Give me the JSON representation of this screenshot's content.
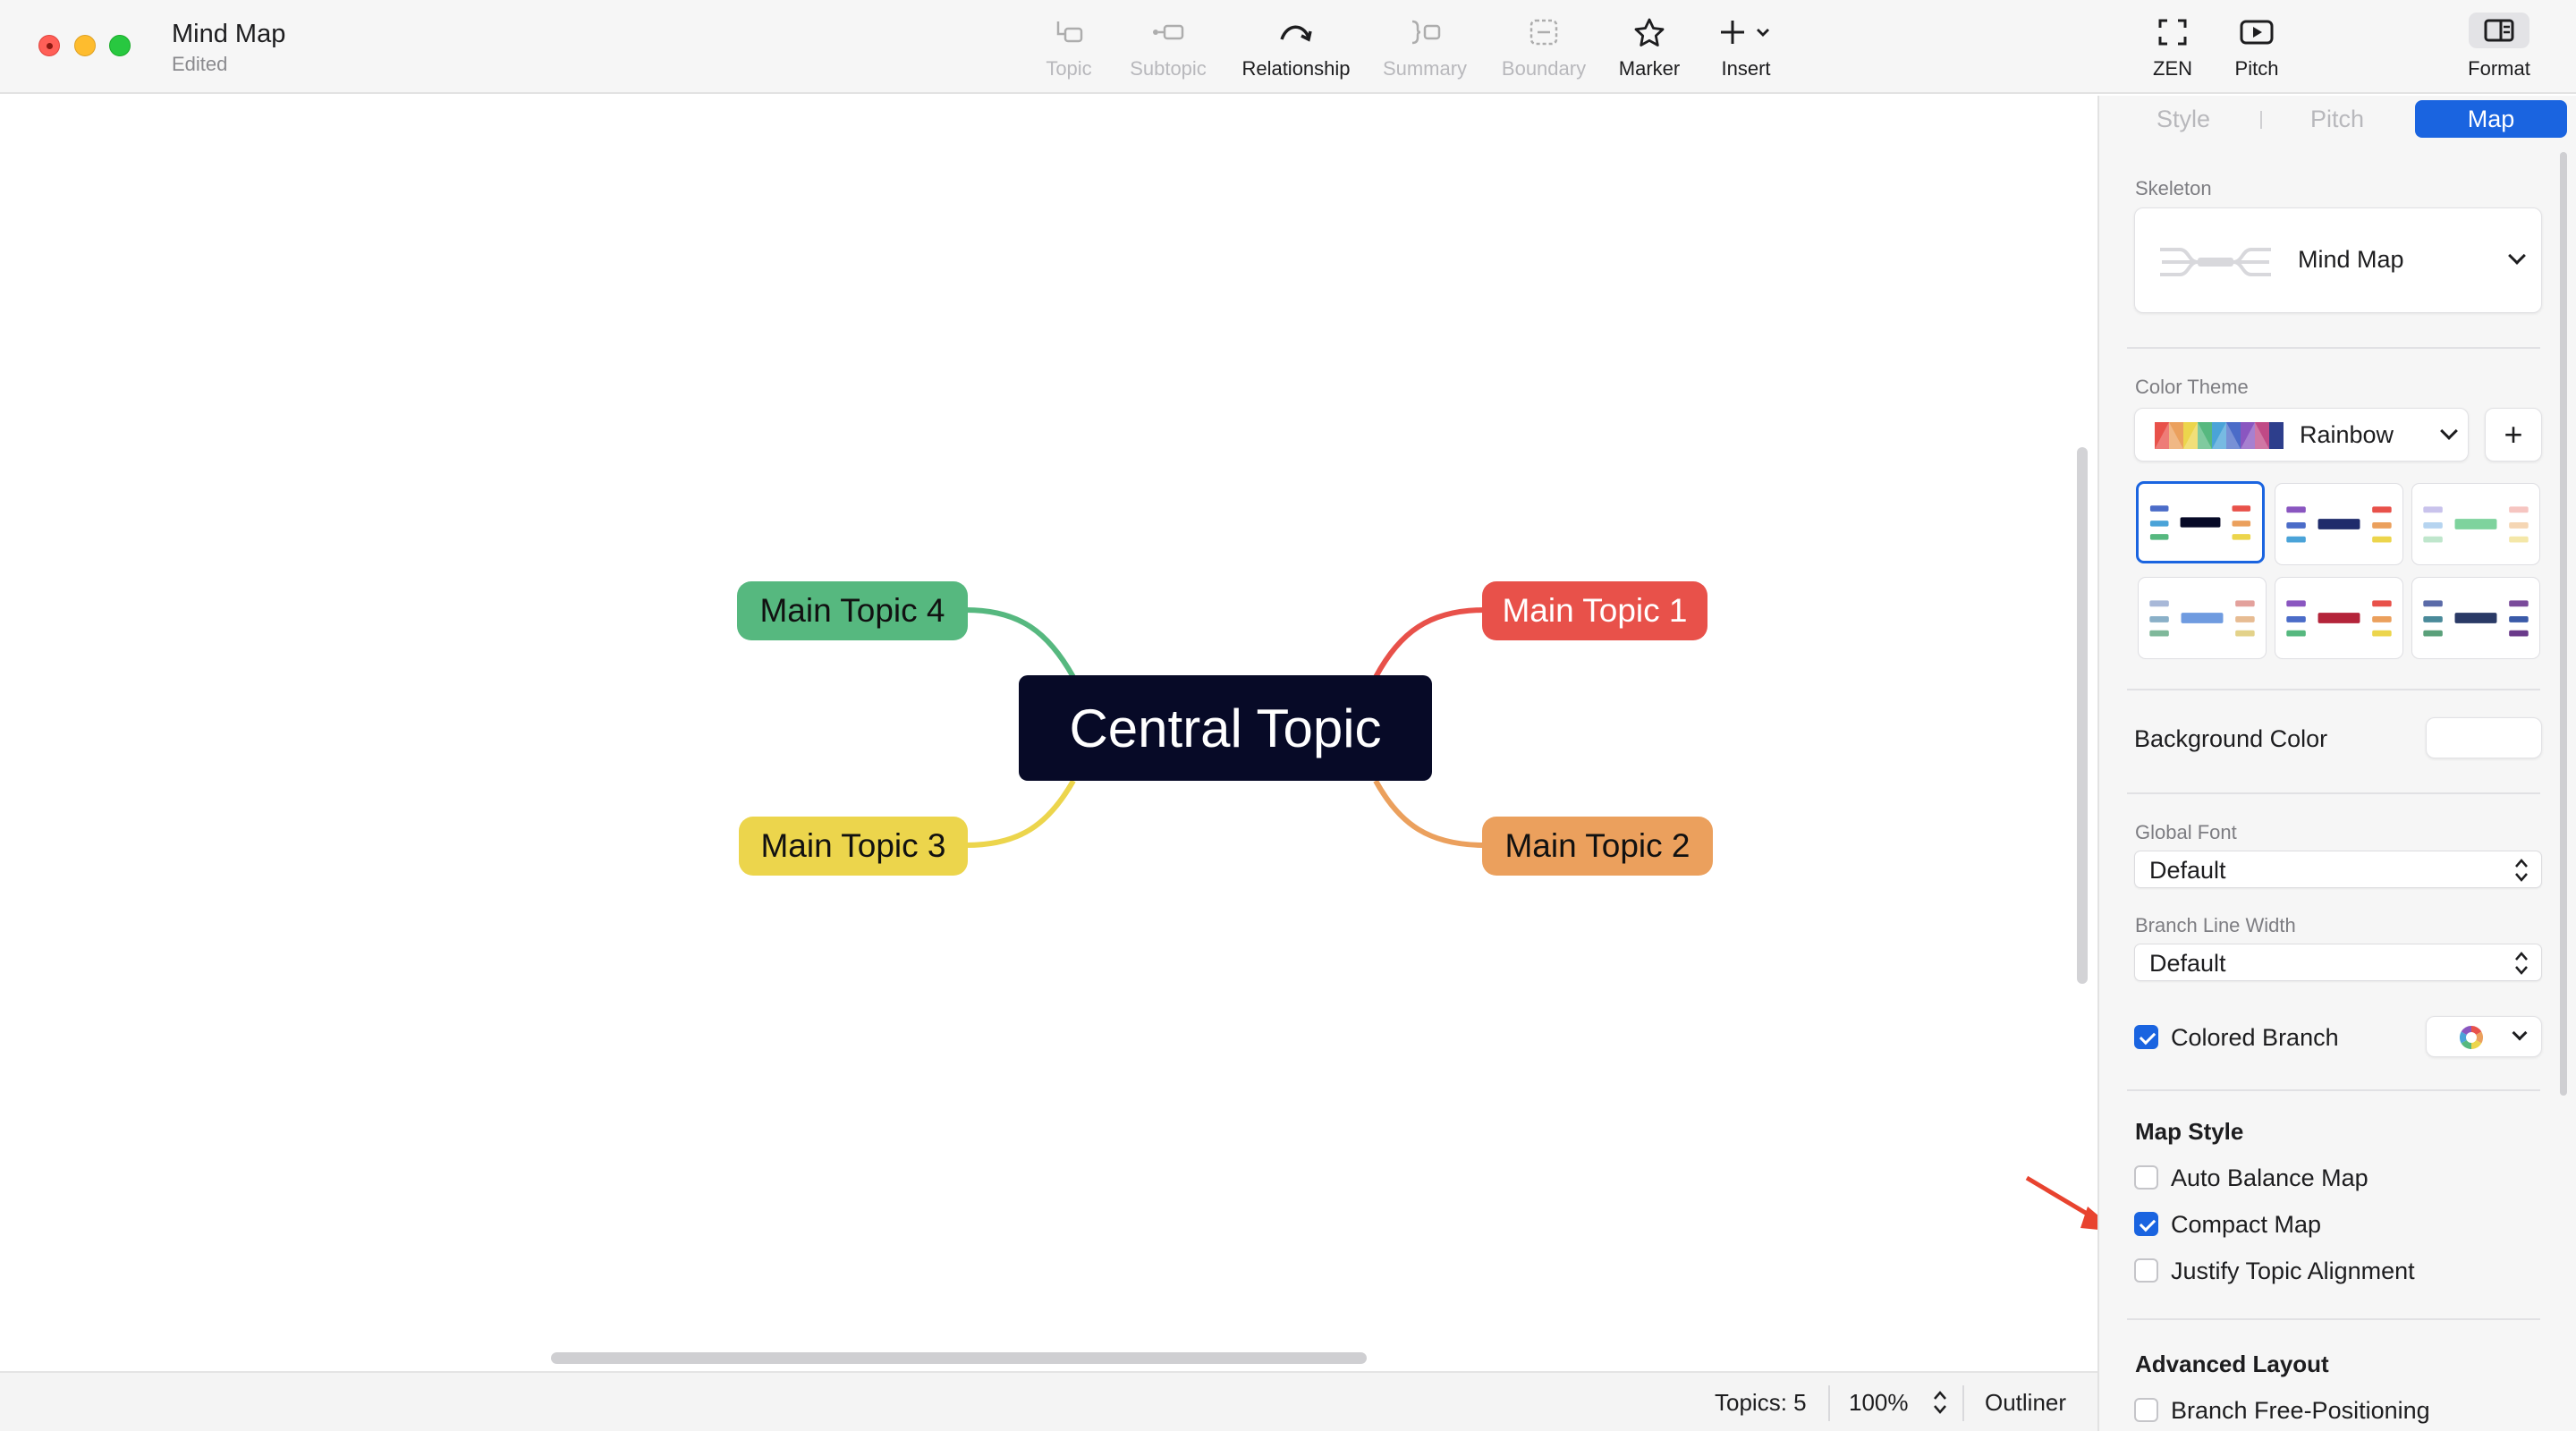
{
  "window": {
    "title": "Mind Map",
    "subtitle": "Edited"
  },
  "toolbar": {
    "items": [
      {
        "label": "Topic",
        "icon": "topic-icon",
        "enabled": false
      },
      {
        "label": "Subtopic",
        "icon": "subtopic-icon",
        "enabled": false
      },
      {
        "label": "Relationship",
        "icon": "relationship-icon",
        "enabled": true
      },
      {
        "label": "Summary",
        "icon": "summary-icon",
        "enabled": false
      },
      {
        "label": "Boundary",
        "icon": "boundary-icon",
        "enabled": false
      },
      {
        "label": "Marker",
        "icon": "star-icon",
        "enabled": true
      },
      {
        "label": "Insert",
        "icon": "plus-icon",
        "enabled": true
      }
    ],
    "right_items": [
      {
        "label": "ZEN",
        "icon": "fullscreen-icon"
      },
      {
        "label": "Pitch",
        "icon": "play-icon"
      },
      {
        "label": "Format",
        "icon": "format-panel-icon"
      }
    ]
  },
  "mindmap": {
    "central": "Central Topic",
    "topics": [
      {
        "label": "Main Topic 1",
        "color": "#e8514a"
      },
      {
        "label": "Main Topic 2",
        "color": "#eba05d"
      },
      {
        "label": "Main Topic 3",
        "color": "#ecd54c"
      },
      {
        "label": "Main Topic 4",
        "color": "#56b87f"
      }
    ]
  },
  "statusbar": {
    "topics": "Topics: 5",
    "zoom": "100%",
    "outliner": "Outliner"
  },
  "panel": {
    "tabs": [
      {
        "label": "Style",
        "active": false
      },
      {
        "label": "Pitch",
        "active": false
      },
      {
        "label": "Map",
        "active": true
      }
    ],
    "skeleton": {
      "label": "Skeleton",
      "value": "Mind Map"
    },
    "color_theme": {
      "label": "Color Theme",
      "value": "Rainbow",
      "add": "+"
    },
    "background_color": {
      "label": "Background Color",
      "value": "#ffffff"
    },
    "global_font": {
      "label": "Global Font",
      "value": "Default"
    },
    "branch_line_width": {
      "label": "Branch Line Width",
      "value": "Default"
    },
    "colored_branch": {
      "label": "Colored Branch",
      "checked": true
    },
    "map_style": {
      "title": "Map Style",
      "options": [
        {
          "label": "Auto Balance Map",
          "checked": false
        },
        {
          "label": "Compact Map",
          "checked": true
        },
        {
          "label": "Justify Topic Alignment",
          "checked": false
        }
      ]
    },
    "advanced_layout": {
      "title": "Advanced Layout",
      "options": [
        {
          "label": "Branch Free-Positioning",
          "checked": false
        }
      ]
    }
  },
  "colors": {
    "accent": "#1a64e0",
    "central_bg": "#070a27",
    "annotation_arrow": "#e8432f"
  }
}
